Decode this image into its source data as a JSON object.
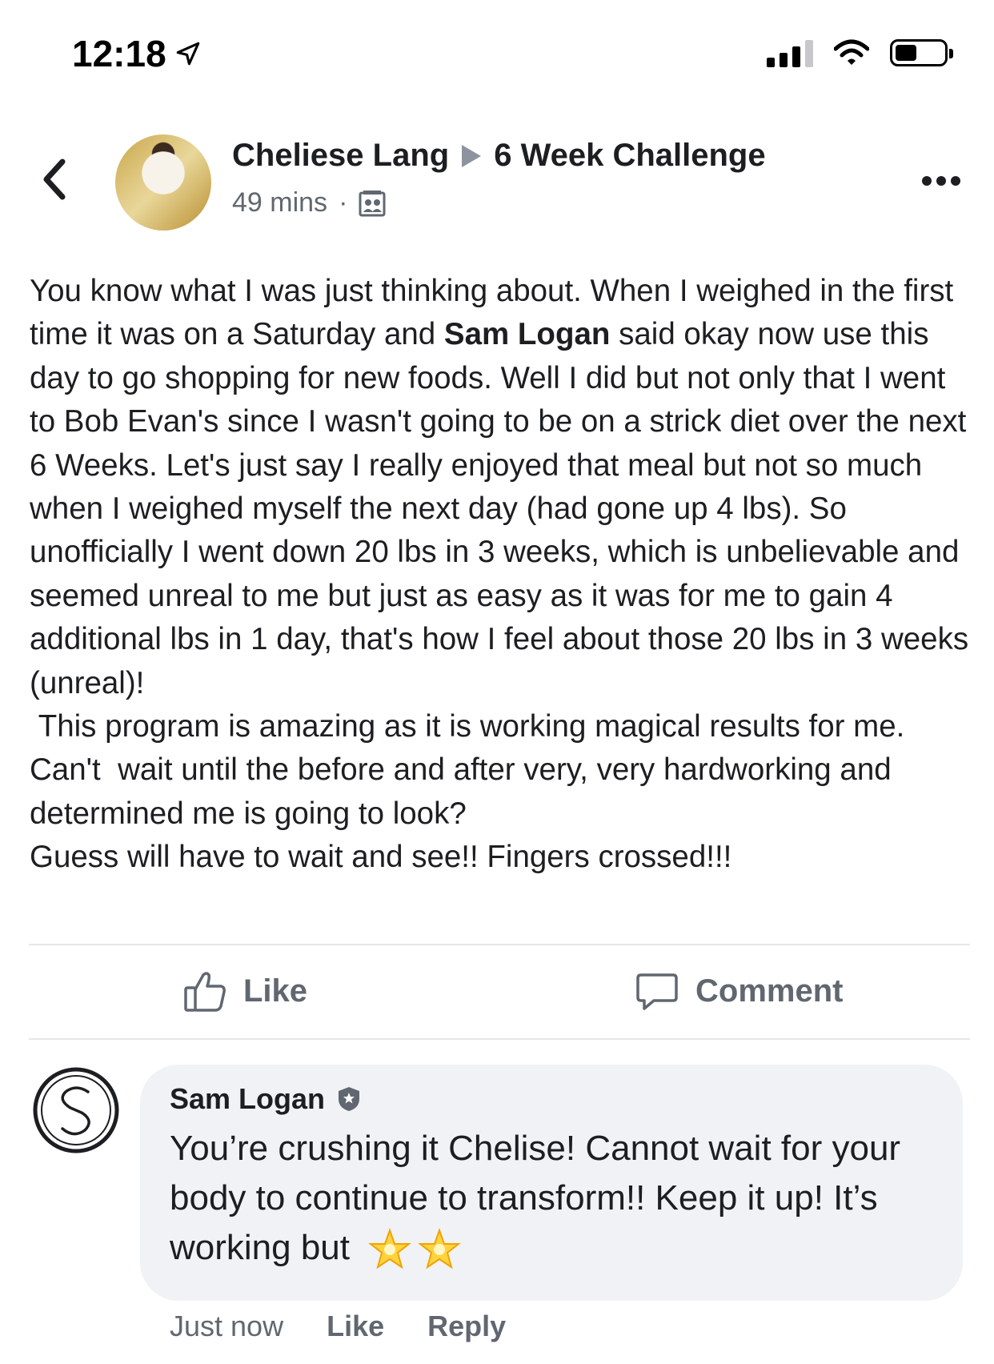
{
  "status_bar": {
    "time": "12:18"
  },
  "header": {
    "author": "Cheliese Lang",
    "group": "6 Week Challenge",
    "timestamp": "49 mins",
    "separator": "·",
    "audience_icon": "group-members-icon"
  },
  "post": {
    "paragraph_1_before": "You know what I was just thinking about. When I weighed in the first time it was on a Saturday and ",
    "mention": "Sam Logan",
    "paragraph_1_after": " said okay now use this day to go shopping for new foods. Well I did but not only that I went to Bob Evan's since I wasn't going to be on a strick diet over the next 6 Weeks. Let's just say I really enjoyed that meal but not so much when I weighed myself the next day (had gone up 4 lbs). So unofficially I went down 20 lbs in 3 weeks, which is unbelievable and seemed unreal to me but just as easy as it was for me to gain 4 additional lbs in 1 day, that's how I feel about those 20 lbs in 3 weeks (unreal)!\n This program is amazing as it is working magical results for me. Can't  wait until the before and after very, very hardworking and determined me is going to look?\nGuess will have to wait and see!! Fingers crossed!!!"
  },
  "actions": {
    "like_label": "Like",
    "comment_label": "Comment"
  },
  "comment": {
    "author": "Sam Logan",
    "text": "You’re crushing it Chelise!  Cannot wait for your body to continue to transform!! Keep it up! It’s working but",
    "emoji": "🌟🌟",
    "time": "Just now",
    "like_label": "Like",
    "reply_label": "Reply"
  },
  "colors": {
    "text_primary": "#1c1e21",
    "text_secondary": "#606770",
    "bubble_bg": "#f0f2f5",
    "divider": "#e4e6eb"
  }
}
